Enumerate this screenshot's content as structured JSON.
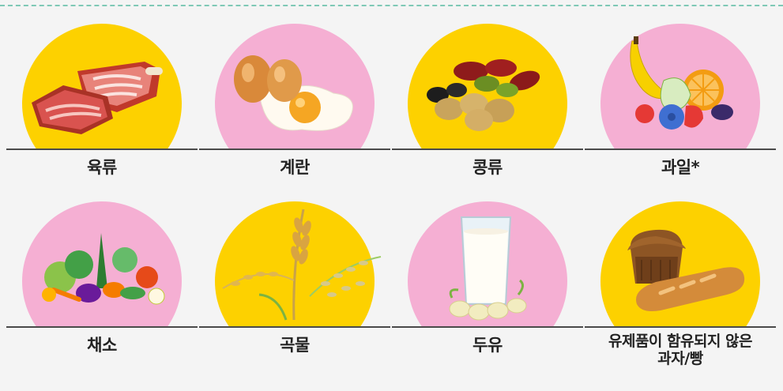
{
  "colors": {
    "yellow": "#fdd100",
    "pink": "#f5afd3",
    "line": "#4a4a4a",
    "text": "#222222"
  },
  "items": [
    {
      "label": "육류",
      "icon": "meat-icon",
      "bg": "yellow"
    },
    {
      "label": "계란",
      "icon": "egg-icon",
      "bg": "pink"
    },
    {
      "label": "콩류",
      "icon": "beans-icon",
      "bg": "yellow"
    },
    {
      "label": "과일*",
      "icon": "fruit-icon",
      "bg": "pink"
    },
    {
      "label": "채소",
      "icon": "vegetables-icon",
      "bg": "pink"
    },
    {
      "label": "곡물",
      "icon": "grain-icon",
      "bg": "yellow"
    },
    {
      "label": "두유",
      "icon": "soy-milk-icon",
      "bg": "pink"
    },
    {
      "label": "유제품이 함유되지 않은 과자/빵",
      "label_line1": "유제품이 함유되지 않은",
      "label_line2": "과자/빵",
      "icon": "bread-icon",
      "bg": "yellow"
    }
  ]
}
